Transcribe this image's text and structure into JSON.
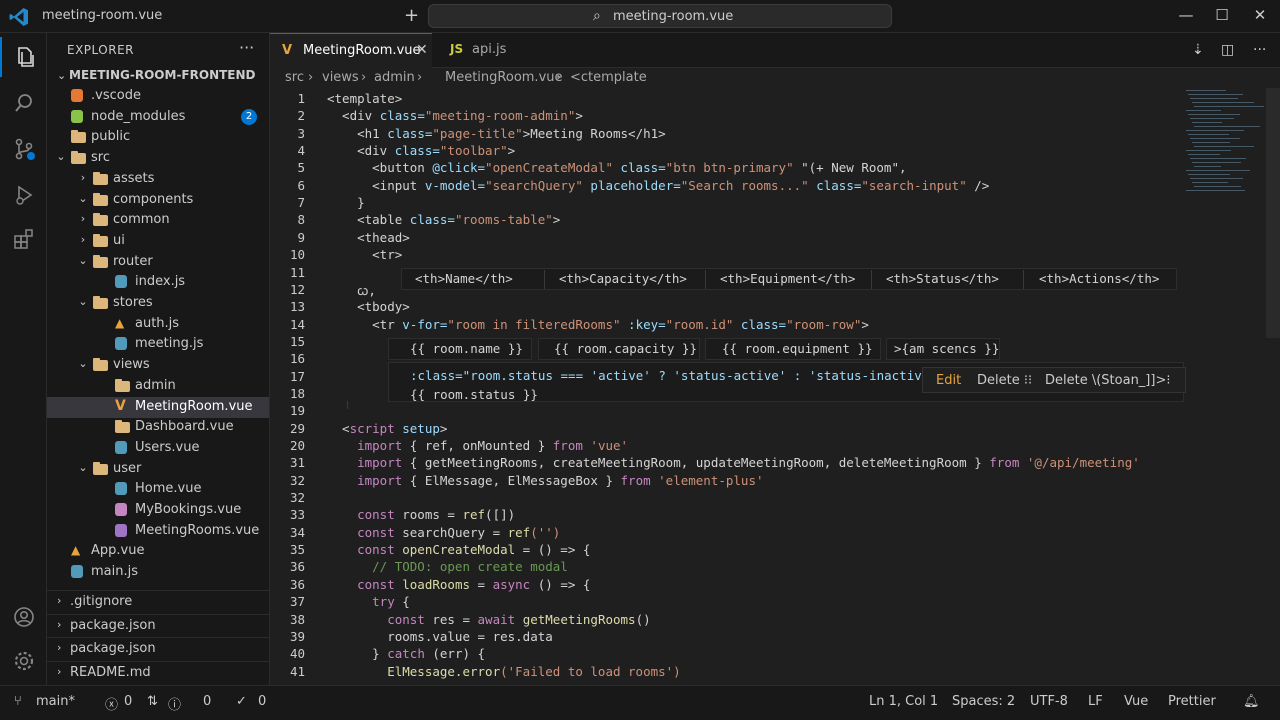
{
  "window": {
    "title": "meeting-room.vue",
    "search_text": "meeting-room.vue",
    "accent": "#0078d4"
  },
  "explorer": {
    "title": "EXPLORER",
    "more": "···",
    "section": "MEETING-ROOM-FRONTEND",
    "tree": [
      {
        "label": ".vscode",
        "icon": "vscode-icon",
        "depth": 0,
        "chev": ""
      },
      {
        "label": "node_modules",
        "icon": "node-icon",
        "depth": 0,
        "chev": "",
        "badge": "2"
      },
      {
        "label": "public",
        "icon": "public-icon",
        "depth": 0,
        "chev": ""
      },
      {
        "label": "src",
        "icon": "folder-icon",
        "depth": 0,
        "chev": "⌄"
      },
      {
        "label": "assets",
        "icon": "folder-icon",
        "depth": 1,
        "chev": "›"
      },
      {
        "label": "components",
        "icon": "folder-icon",
        "depth": 1,
        "chev": "⌄"
      },
      {
        "label": "common",
        "icon": "folder-icon",
        "depth": 1,
        "chev": "›"
      },
      {
        "label": "ui",
        "icon": "folder-icon",
        "depth": 1,
        "chev": "›"
      },
      {
        "label": "router",
        "icon": "folder-icon",
        "depth": 1,
        "chev": "⌄"
      },
      {
        "label": "index.js",
        "icon": "js-icon",
        "depth": 2,
        "chev": ""
      },
      {
        "label": "stores",
        "icon": "folder-icon",
        "depth": 1,
        "chev": "⌄"
      },
      {
        "label": "auth.js",
        "icon": "warn-icon",
        "depth": 2,
        "chev": ""
      },
      {
        "label": "meeting.js",
        "icon": "js-icon",
        "depth": 2,
        "chev": ""
      },
      {
        "label": "views",
        "icon": "folder-icon",
        "depth": 1,
        "chev": "⌄"
      },
      {
        "label": "admin",
        "icon": "folder-icon",
        "depth": 2,
        "chev": ""
      },
      {
        "label": "MeetingRoom.vue",
        "icon": "vue-icon",
        "depth": 2,
        "chev": "",
        "selected": true
      },
      {
        "label": "Dashboard.vue",
        "icon": "folder-icon",
        "depth": 2,
        "chev": ""
      },
      {
        "label": "Users.vue",
        "icon": "js-icon",
        "depth": 2,
        "chev": ""
      },
      {
        "label": "user",
        "icon": "folder-icon",
        "depth": 1,
        "chev": "⌄"
      },
      {
        "label": "Home.vue",
        "icon": "file-icon",
        "depth": 2,
        "chev": ""
      },
      {
        "label": "MyBookings.vue",
        "icon": "vue-pink-icon",
        "depth": 2,
        "chev": ""
      },
      {
        "label": "MeetingRooms.vue",
        "icon": "gear-file-icon",
        "depth": 2,
        "chev": ""
      },
      {
        "label": "App.vue",
        "icon": "warn-icon",
        "depth": 0,
        "chev": ""
      },
      {
        "label": "main.js",
        "icon": "js-icon",
        "depth": 0,
        "chev": ""
      }
    ],
    "bottom": [
      ".gitignore",
      "package.json",
      "package.json",
      "README.md"
    ]
  },
  "tabs": [
    {
      "label": "MeetingRoom.vue",
      "icon": "V",
      "active": true
    },
    {
      "label": "api.js",
      "icon": "JS",
      "active": false
    }
  ],
  "breadcrumb": [
    "src",
    "views",
    "admin",
    "MeetingRoom.vue",
    "<ctemplate"
  ],
  "gutter": [
    "1",
    "2",
    "3",
    "4",
    "5",
    "6",
    "7",
    "8",
    "9",
    "10",
    "11",
    "12",
    "13",
    "14",
    "15",
    "16",
    "17",
    "18",
    "19",
    "29",
    "20",
    "31",
    "32",
    "32",
    "33",
    "34",
    "35",
    "36",
    "36",
    "37",
    "38",
    "39",
    "40",
    "41"
  ],
  "code": [
    [
      [
        "c-tag",
        "<template>"
      ]
    ],
    [
      [
        "c-tag",
        "  <div "
      ],
      [
        "c-attr",
        "class="
      ],
      [
        "c-str",
        "\"meeting-room-admin\""
      ],
      [
        "c-tag",
        ">"
      ]
    ],
    [
      [
        "c-tag",
        "    <h1 "
      ],
      [
        "c-attr",
        "class="
      ],
      [
        "c-str",
        "\"page-title\""
      ],
      [
        "c-tag",
        ">Meeting Rooms</h1>"
      ]
    ],
    [
      [
        "c-tag",
        "    <div "
      ],
      [
        "c-attr",
        "class="
      ],
      [
        "c-str",
        "\"toolbar\""
      ],
      [
        "c-tag",
        ">"
      ]
    ],
    [
      [
        "c-tag",
        "      <button "
      ],
      [
        "c-attr",
        "@click="
      ],
      [
        "c-str",
        "\"openCreateModal\""
      ],
      [
        "c-attr",
        " class="
      ],
      [
        "c-str",
        "\"btn btn-primary\""
      ],
      [
        "c-tag",
        " \"(+ New Room\","
      ]
    ],
    [
      [
        "c-tag",
        "      <input "
      ],
      [
        "c-attr",
        "v-model="
      ],
      [
        "c-str",
        "\"searchQuery\""
      ],
      [
        "c-attr",
        " placeholder="
      ],
      [
        "c-str",
        "\"Search rooms...\""
      ],
      [
        "c-attr",
        " class="
      ],
      [
        "c-str",
        "\"search-input\""
      ],
      [
        "c-tag",
        " />"
      ]
    ],
    [
      [
        "c-tag",
        "    }"
      ]
    ],
    [
      [
        "c-tag",
        "    <table "
      ],
      [
        "c-attr",
        "class="
      ],
      [
        "c-str",
        "\"rooms-table\""
      ],
      [
        "c-tag",
        ">"
      ]
    ],
    [
      [
        "c-tag",
        "    <thead>"
      ]
    ],
    [
      [
        "c-tag",
        "      <tr>"
      ]
    ],
    [],
    [
      [
        "c-tag",
        "    ꞷ,"
      ]
    ],
    [
      [
        "c-tag",
        "    <tbody>"
      ]
    ],
    [
      [
        "c-tag",
        "      <tr "
      ],
      [
        "c-attr",
        "v-for="
      ],
      [
        "c-str",
        "\"room in filteredRooms\""
      ],
      [
        "c-attr",
        " :key="
      ],
      [
        "c-str",
        "\"room.id\""
      ],
      [
        "c-attr",
        " class="
      ],
      [
        "c-str",
        "\"room-row\""
      ],
      [
        "c-tag",
        ">"
      ]
    ],
    [],
    [],
    [],
    [],
    [],
    [
      [
        "c-tag",
        "  <"
      ],
      [
        "c-kw",
        "script"
      ],
      [
        "c-attr",
        " setup"
      ],
      [
        "c-tag",
        ">"
      ]
    ],
    [
      [
        "c-kw",
        "    import"
      ],
      [
        "c-var",
        " { ref, onMounted } "
      ],
      [
        "c-kw",
        "from"
      ],
      [
        "c-str",
        " 'vue'"
      ]
    ],
    [
      [
        "c-kw",
        "    import"
      ],
      [
        "c-var",
        " { getMeetingRooms, createMeetingRoom, updateMeetingRoom, deleteMeetingRoom } "
      ],
      [
        "c-kw",
        "from"
      ],
      [
        "c-str",
        " '@/api/meeting'"
      ]
    ],
    [
      [
        "c-kw",
        "    import"
      ],
      [
        "c-var",
        " { ElMessage, ElMessageBox } "
      ],
      [
        "c-kw",
        "from"
      ],
      [
        "c-str",
        " 'element-plus'"
      ]
    ],
    [],
    [
      [
        "c-kw",
        "    const"
      ],
      [
        "c-var",
        " rooms = "
      ],
      [
        "c-fn",
        "ref"
      ],
      [
        "c-var",
        "([])"
      ]
    ],
    [
      [
        "c-kw",
        "    const"
      ],
      [
        "c-var",
        " searchQuery = "
      ],
      [
        "c-fn",
        "ref"
      ],
      [
        "c-str",
        "('')"
      ]
    ],
    [
      [
        "c-kw",
        "    const"
      ],
      [
        "c-fn",
        " openCreateModal"
      ],
      [
        "c-var",
        " = () => {"
      ]
    ],
    [
      [
        "c-com",
        "      // TODO: open create modal"
      ]
    ],
    [
      [
        "c-kw",
        "    const"
      ],
      [
        "c-fn",
        " loadRooms"
      ],
      [
        "c-var",
        " = "
      ],
      [
        "c-kw",
        "async"
      ],
      [
        "c-var",
        " () => {"
      ]
    ],
    [
      [
        "c-kw",
        "      try"
      ],
      [
        "c-var",
        " {"
      ]
    ],
    [
      [
        "c-kw",
        "        const"
      ],
      [
        "c-var",
        " res = "
      ],
      [
        "c-kw",
        "await"
      ],
      [
        "c-fn",
        " getMeetingRooms"
      ],
      [
        "c-var",
        "()"
      ]
    ],
    [
      [
        "c-var",
        "        rooms.value = res.data"
      ]
    ],
    [
      [
        "c-var",
        "      } "
      ],
      [
        "c-kw",
        "catch"
      ],
      [
        "c-var",
        " (err) {"
      ]
    ],
    [
      [
        "c-fn",
        "        ElMessage.error"
      ],
      [
        "c-str",
        "('Failed to load rooms')"
      ]
    ]
  ],
  "thead_cells": [
    "<th>Name</th>",
    "<th>Capacity</th>",
    "<th>Equipment</th>",
    "<th>Status</th>",
    "<th>Actions</th>"
  ],
  "tbody_cells": [
    "{{ room.name }}",
    "{{ room.capacity }}",
    "{{ room.equipment }}",
    ">{am scencs }}"
  ],
  "status_line": ":class=\"room.status === 'active' ? 'status-active' : 'status-inactive'",
  "status_value": "{{ room.status }}",
  "actions_pop": {
    "edit": "Edit",
    "delete1": "Delete ⁝⁝",
    "delete2": "Delete  \\(Stoan_]]>⁝"
  },
  "statusbar": {
    "branch": "main*",
    "errors": "0",
    "warnings": "0",
    "info": "0",
    "position": "Ln 1, Col 1",
    "spaces": "Spaces: 2",
    "encoding": "UTF-8",
    "eol": "LF",
    "language": "Vue",
    "formatter": "Prettier"
  }
}
